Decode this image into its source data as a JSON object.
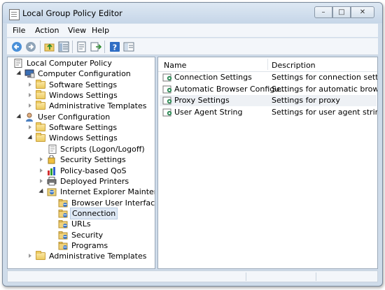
{
  "window": {
    "title": "Local Group Policy Editor"
  },
  "window_buttons": {
    "minimize": "–",
    "maximize": "□",
    "close": "✕"
  },
  "menu": [
    "File",
    "Action",
    "View",
    "Help"
  ],
  "toolbar": [
    "back-icon",
    "forward-icon",
    "up-folder-icon",
    "show-hide-tree-icon",
    "properties-icon",
    "export-list-icon",
    "help-icon",
    "extended-view-icon"
  ],
  "tree": [
    {
      "label": "Local Computer Policy",
      "icon": "computer-policy-icon",
      "level": 0,
      "expander": "none"
    },
    {
      "label": "Computer Configuration",
      "icon": "computer-icon",
      "level": 1,
      "expander": "expanded"
    },
    {
      "label": "Software Settings",
      "icon": "folder-icon",
      "level": 2,
      "expander": "collapsed"
    },
    {
      "label": "Windows Settings",
      "icon": "folder-icon",
      "level": 2,
      "expander": "collapsed"
    },
    {
      "label": "Administrative Templates",
      "icon": "folder-icon",
      "level": 2,
      "expander": "collapsed"
    },
    {
      "label": "User Configuration",
      "icon": "user-icon",
      "level": 1,
      "expander": "expanded"
    },
    {
      "label": "Software Settings",
      "icon": "folder-icon",
      "level": 2,
      "expander": "collapsed"
    },
    {
      "label": "Windows Settings",
      "icon": "folder-icon",
      "level": 2,
      "expander": "expanded"
    },
    {
      "label": "Scripts (Logon/Logoff)",
      "icon": "scripts-icon",
      "level": 3,
      "expander": "none"
    },
    {
      "label": "Security Settings",
      "icon": "security-settings-icon",
      "level": 3,
      "expander": "collapsed"
    },
    {
      "label": "Policy-based QoS",
      "icon": "qos-chart-icon",
      "level": 3,
      "expander": "collapsed"
    },
    {
      "label": "Deployed Printers",
      "icon": "printer-icon",
      "level": 3,
      "expander": "collapsed"
    },
    {
      "label": "Internet Explorer Maintenance",
      "icon": "ie-maintenance-icon",
      "level": 3,
      "expander": "expanded"
    },
    {
      "label": "Browser User Interface",
      "icon": "ie-folder-icon",
      "level": 4,
      "expander": "none"
    },
    {
      "label": "Connection",
      "icon": "ie-folder-icon",
      "level": 4,
      "expander": "none",
      "selected": true
    },
    {
      "label": "URLs",
      "icon": "ie-folder-icon",
      "level": 4,
      "expander": "none"
    },
    {
      "label": "Security",
      "icon": "ie-folder-icon",
      "level": 4,
      "expander": "none"
    },
    {
      "label": "Programs",
      "icon": "ie-folder-icon",
      "level": 4,
      "expander": "none"
    },
    {
      "label": "Administrative Templates",
      "icon": "folder-icon",
      "level": 2,
      "expander": "collapsed"
    }
  ],
  "list": {
    "columns": [
      "Name",
      "Description"
    ],
    "rows": [
      {
        "name": "Connection Settings",
        "description": "Settings for connection settings",
        "highlight": false
      },
      {
        "name": "Automatic Browser Configu...",
        "description": "Settings for automatic browse...",
        "highlight": false
      },
      {
        "name": "Proxy Settings",
        "description": "Settings for proxy",
        "highlight": true
      },
      {
        "name": "User Agent String",
        "description": "Settings for user agent string",
        "highlight": false
      }
    ]
  },
  "colors": {
    "selection": "#dfe9f5",
    "row_highlight": "#eef1f5",
    "frame": "#cfdcea"
  }
}
